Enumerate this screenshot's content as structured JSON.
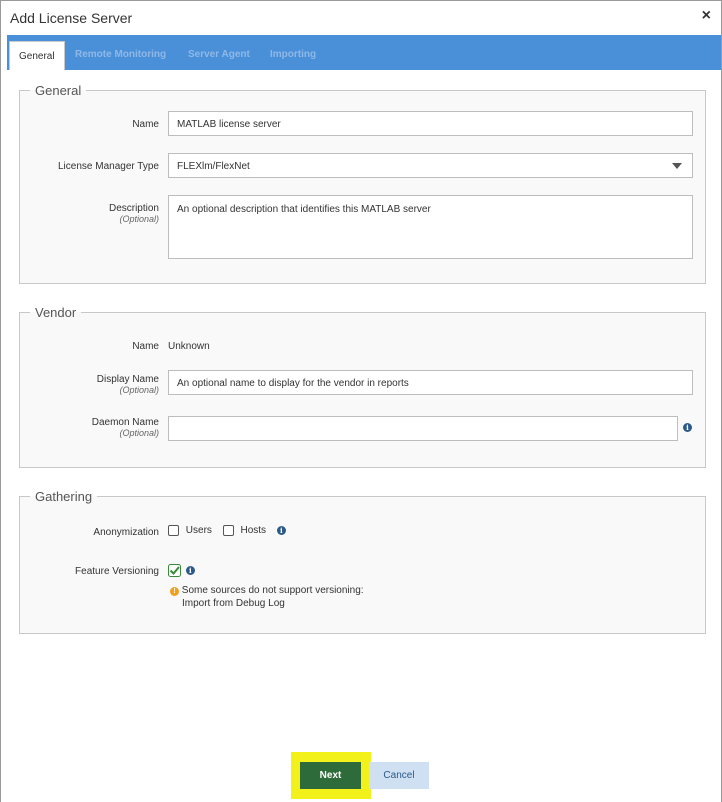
{
  "dialog": {
    "title": "Add License Server",
    "close_glyph": "×"
  },
  "tabs": [
    {
      "label": "General",
      "active": true
    },
    {
      "label": "Remote Monitoring",
      "active": false
    },
    {
      "label": "Server Agent",
      "active": false
    },
    {
      "label": "Importing",
      "active": false
    }
  ],
  "general": {
    "legend": "General",
    "name_label": "Name",
    "name_value": "MATLAB license server",
    "type_label": "License Manager Type",
    "type_value": "FLEXlm/FlexNet",
    "description_label": "Description",
    "description_optional": "(Optional)",
    "description_placeholder": "An optional description that identifies this MATLAB server"
  },
  "vendor": {
    "legend": "Vendor",
    "name_label": "Name",
    "name_value": "Unknown",
    "display_name_label": "Display Name",
    "display_name_optional": "(Optional)",
    "display_name_placeholder": "An optional name to display for the vendor in reports",
    "daemon_name_label": "Daemon Name",
    "daemon_name_optional": "(Optional)",
    "daemon_name_value": ""
  },
  "gathering": {
    "legend": "Gathering",
    "anonymization_label": "Anonymization",
    "users_label": "Users",
    "users_checked": false,
    "hosts_label": "Hosts",
    "hosts_checked": false,
    "feature_versioning_label": "Feature Versioning",
    "feature_versioning_checked": true,
    "warning_line1": "Some sources do not support versioning:",
    "warning_line2": "Import from Debug Log"
  },
  "footer": {
    "next_label": "Next",
    "cancel_label": "Cancel"
  },
  "colors": {
    "tabbar": "#4a90d9",
    "next_button": "#2e6b3a",
    "highlight": "#f2f21a",
    "cancel_button": "#cfe0f2",
    "checkbox_green": "#3a8a3a"
  }
}
